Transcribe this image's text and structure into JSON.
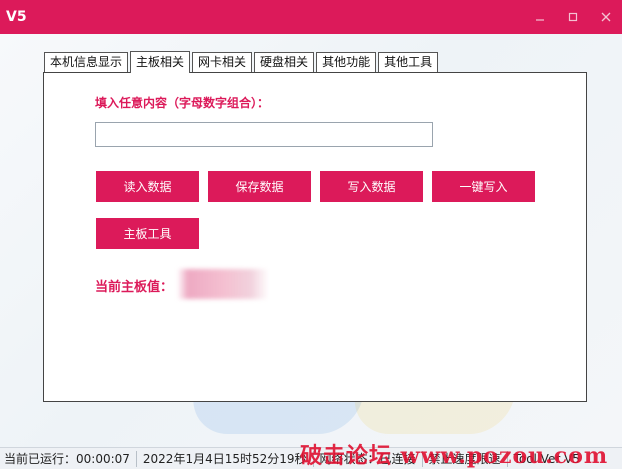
{
  "window": {
    "title": "V5",
    "accent_color": "#dc1a5a"
  },
  "tabs": [
    {
      "label": "本机信息显示"
    },
    {
      "label": "主板相关"
    },
    {
      "label": "网卡相关"
    },
    {
      "label": "硬盘相关"
    },
    {
      "label": "其他功能"
    },
    {
      "label": "其他工具"
    }
  ],
  "active_tab": "主板相关",
  "panel": {
    "input_label": "填入任意内容（字母数字组合）：",
    "input_value": "",
    "buttons": {
      "read": "读入数据",
      "save": "保存数据",
      "write": "写入数据",
      "one_click_write": "一键写入",
      "board_tool": "主板工具"
    },
    "current_board_label": "当前主板值："
  },
  "statusbar": {
    "runtime": "当前已运行：00:00:07",
    "datetime": "2022年1月4日15时52分19秒",
    "network": "网络状态：已连接",
    "speed_limit": "禁止速度限速",
    "version": "Tool Ver V5"
  },
  "watermark": {
    "text": "破击论坛  www.pozou.com"
  }
}
